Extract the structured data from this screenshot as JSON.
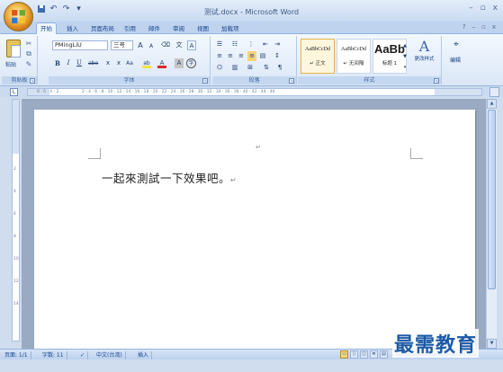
{
  "window": {
    "title": "测试.docx - Microsoft Word",
    "controls": [
      "–",
      "▫",
      "x"
    ]
  },
  "qat": {
    "save_icon": "save-icon",
    "undo_icon": "undo-icon",
    "redo_icon": "redo-icon",
    "customize_icon": "customize-icon"
  },
  "tabs": [
    {
      "label": "开始",
      "active": true
    },
    {
      "label": "插入"
    },
    {
      "label": "页面布局"
    },
    {
      "label": "引用"
    },
    {
      "label": "邮件"
    },
    {
      "label": "审阅"
    },
    {
      "label": "视图"
    },
    {
      "label": "加载项"
    }
  ],
  "tab_right": {
    "help": "?",
    "min": "–",
    "restore": "▫",
    "close": "x"
  },
  "ribbon": {
    "clipboard": {
      "label": "剪贴板",
      "paste": "粘贴"
    },
    "font": {
      "label": "字体",
      "font_name": "PMingLiU",
      "font_size": "三号",
      "grow": "A",
      "shrink": "A",
      "phonetic": "文",
      "charborder": "A",
      "bold": "B",
      "italic": "I",
      "underline": "U",
      "strike": "abe",
      "sub": "x",
      "sup": "x",
      "case": "Aa",
      "highlight": "ab",
      "fontcolor": "A",
      "charshade": "A",
      "enclose": "字"
    },
    "paragraph": {
      "label": "段落"
    },
    "styles": {
      "label": "样式",
      "items": [
        {
          "preview": "AaBbCcDd",
          "name": "↵ 正文",
          "selected": true
        },
        {
          "preview": "AaBbCcDd",
          "name": "↵ 无间隔"
        },
        {
          "preview": "AaBb",
          "name": "标题 1"
        }
      ],
      "change_styles": "更改样式"
    },
    "editing": {
      "label": "编辑"
    }
  },
  "document": {
    "text": "一起來測試一下效果吧。",
    "para_mark": "↵",
    "header_mark": "↵"
  },
  "status": {
    "page": "页面: 1/1",
    "words": "字数: 11",
    "language": "中文(台湾)",
    "mode": "插入"
  },
  "watermark": "最需教育",
  "colors": {
    "ribbon_bg": "#dbe7f6",
    "title_text": "#3c5a86",
    "accent": "#15428b",
    "watermark": "#1c5aa6"
  }
}
